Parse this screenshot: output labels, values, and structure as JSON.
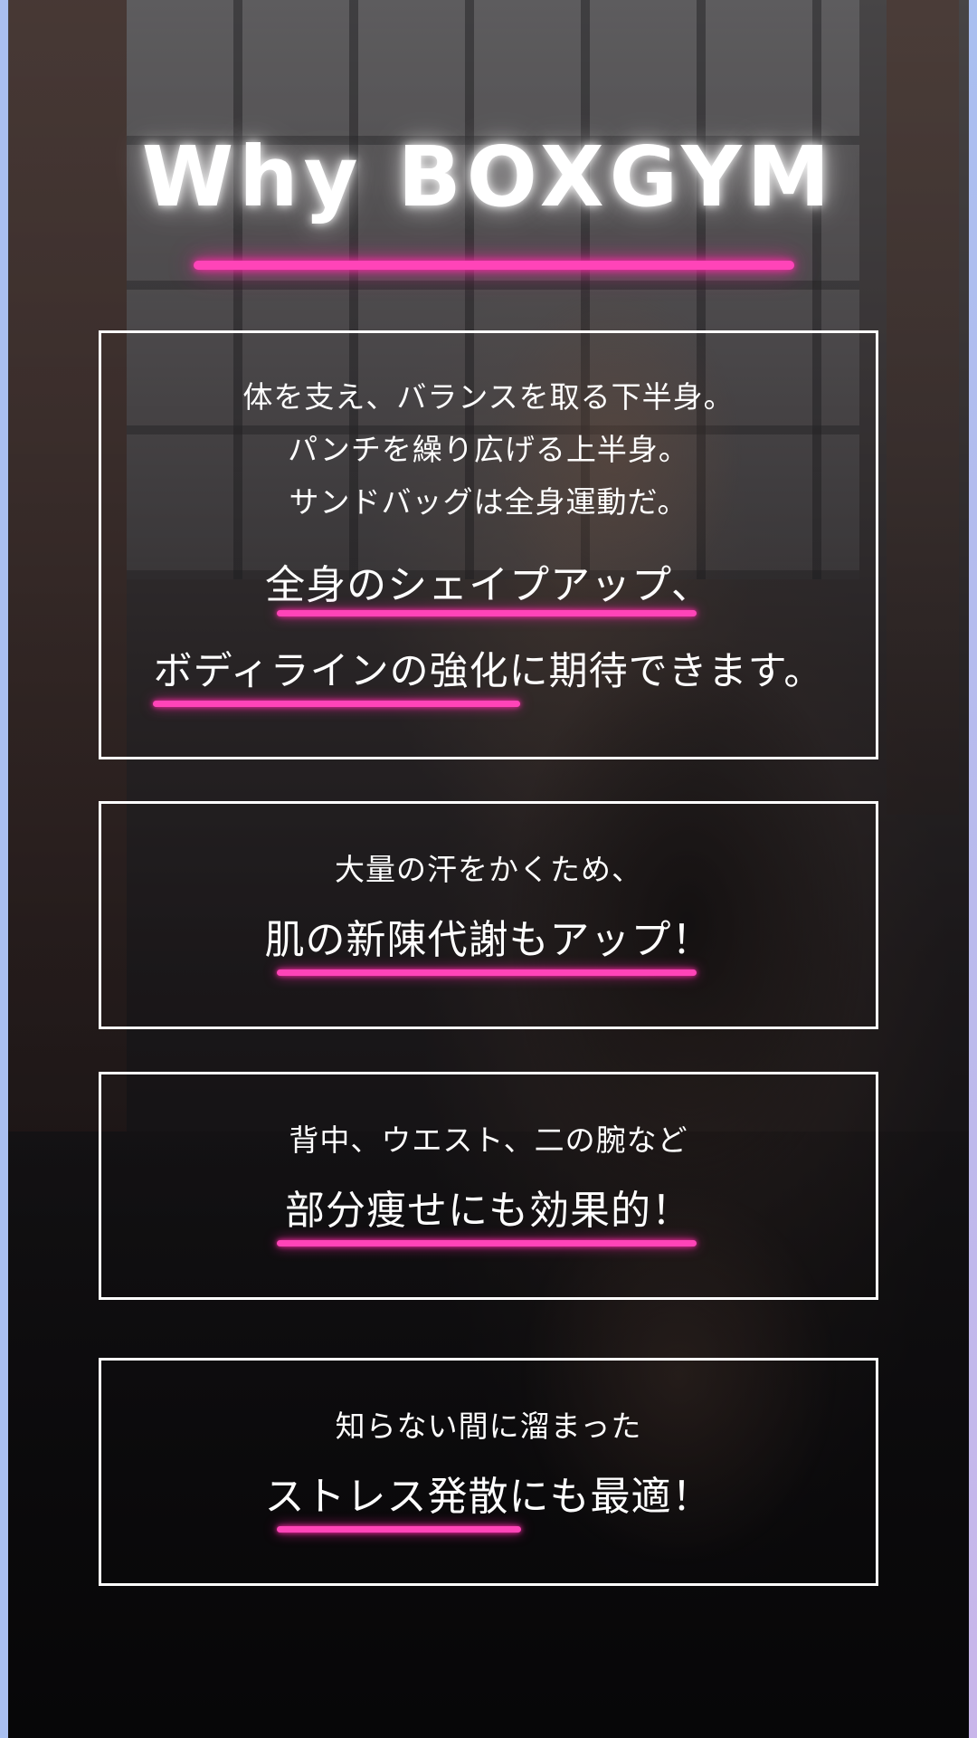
{
  "title": "Why BOXGYM",
  "accent_color": "#ff44b8",
  "cards": [
    {
      "lines": [
        "体を支え、バランスを取る下半身。",
        "パンチを繰り広げる上半身。",
        "サンドバッグは全身運動だ。"
      ],
      "highlights": [
        "全身のシェイプアップ、",
        "ボディラインの強化に期待できます。"
      ]
    },
    {
      "lines": [
        "大量の汗をかくため、"
      ],
      "highlights": [
        "肌の新陳代謝もアップ！"
      ]
    },
    {
      "lines": [
        "背中、ウエスト、二の腕など"
      ],
      "highlights": [
        "部分痩せにも効果的！"
      ]
    },
    {
      "lines": [
        "知らない間に溜まった"
      ],
      "highlights": [
        "ストレス発散にも最適！"
      ]
    }
  ]
}
